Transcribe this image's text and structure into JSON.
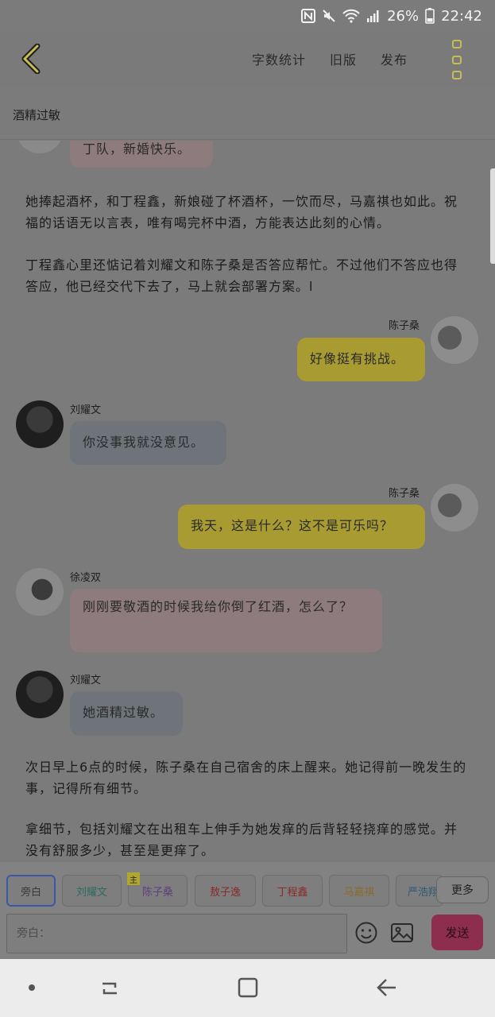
{
  "status_bar": {
    "battery_percent": "26%",
    "time": "22:42",
    "icons": [
      "nfc-icon",
      "mute-icon",
      "wifi-icon",
      "signal-icon",
      "battery-icon"
    ]
  },
  "toolbar": {
    "back_icon": "chevron-left-icon",
    "actions": [
      "字数统计",
      "旧版",
      "发布"
    ],
    "more_icon": "more-vertical-icon"
  },
  "chapter": {
    "title": "酒精过敏"
  },
  "messages": [
    {
      "type": "bubble",
      "speaker": "",
      "text": "丁队，新婚快乐。",
      "color": "pink",
      "side": "left"
    },
    {
      "type": "narration",
      "text": "她捧起酒杯，和丁程鑫，新娘碰了杯酒杯，一饮而尽，马嘉祺也如此。祝福的话语无以言表，唯有喝完杯中酒，方能表达此刻的心情。"
    },
    {
      "type": "narration",
      "text": "丁程鑫心里还惦记着刘耀文和陈子桑是否答应帮忙。不过他们不答应也得答应，他已经交代下去了，马上就会部署方案。l"
    },
    {
      "type": "bubble",
      "speaker": "陈子桑",
      "text": "好像挺有挑战。",
      "color": "yellow",
      "side": "right"
    },
    {
      "type": "bubble",
      "speaker": "刘耀文",
      "text": "你没事我就没意见。",
      "color": "blue",
      "side": "left"
    },
    {
      "type": "bubble",
      "speaker": "陈子桑",
      "text": "我天，这是什么？这不是可乐吗？",
      "color": "yellow",
      "side": "right"
    },
    {
      "type": "bubble",
      "speaker": "徐凌双",
      "text": "刚刚要敬酒的时候我给你倒了红酒，怎么了？",
      "color": "pink",
      "side": "left"
    },
    {
      "type": "bubble",
      "speaker": "刘耀文",
      "text": "她酒精过敏。",
      "color": "blue",
      "side": "left"
    },
    {
      "type": "narration",
      "text": "次日早上6点的时候，陈子桑在自己宿舍的床上醒来。她记得前一晚发生的事，记得所有细节。"
    },
    {
      "type": "narration",
      "text": "拿细节，包括刘耀文在出租车上伸手为她发痒的后背轻轻挠痒的感觉。并没有舒服多少，甚至是更痒了。"
    }
  ],
  "characters": [
    {
      "label": "旁白",
      "color": "#3a3a3a",
      "active": true,
      "main": false
    },
    {
      "label": "刘耀文",
      "color": "#2e6a5d",
      "active": false,
      "main": false
    },
    {
      "label": "陈子桑",
      "color": "#5e3f7e",
      "active": false,
      "main": true,
      "badge": "主"
    },
    {
      "label": "敖子逸",
      "color": "#8a2a2a",
      "active": false,
      "main": false
    },
    {
      "label": "丁程鑫",
      "color": "#8a2a2a",
      "active": false,
      "main": false
    },
    {
      "label": "马嘉祺",
      "color": "#8a6a2a",
      "active": false,
      "main": false
    },
    {
      "label": "严浩翔",
      "color": "#2e5a74",
      "active": false,
      "main": false
    }
  ],
  "more_chip": "更多",
  "input": {
    "placeholder": "旁白：",
    "value": ""
  },
  "send_label": "发送",
  "colors": {
    "accent_yellow": "#c8bd55",
    "send_button": "#8e2e4f",
    "active_chip_border": "#3b57a8"
  }
}
